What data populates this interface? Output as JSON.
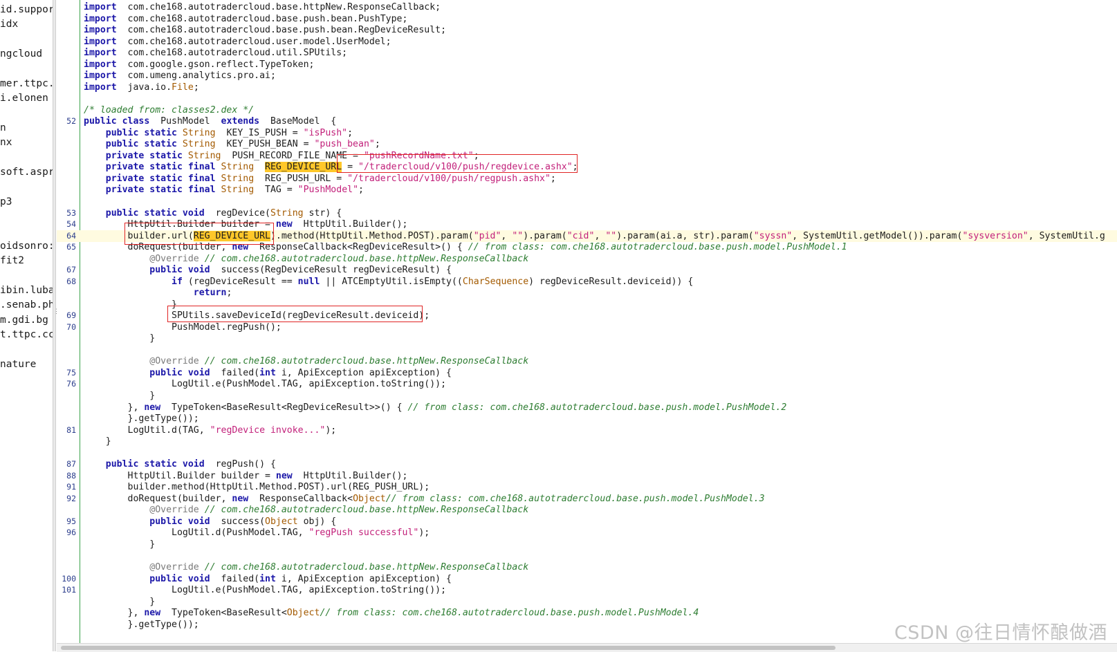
{
  "left_panel": {
    "items": [
      "id.suppor",
      "idx",
      "ngcloud",
      "mer.ttpc.",
      "i.elonen",
      "n",
      "nx",
      "soft.aspr",
      "p3",
      "oidsonro:",
      "fit2",
      "ibin.luba",
      ".senab.ph",
      "m.gdi.bg",
      "t.ttpc.cc",
      "nature"
    ]
  },
  "code_lines": [
    {
      "ln": "",
      "tokens": [
        [
          "kw",
          "import"
        ],
        [
          "",
          "  com.che168.autotradercloud.base.httpNew.ResponseCallback;"
        ]
      ]
    },
    {
      "ln": "",
      "tokens": [
        [
          "kw",
          "import"
        ],
        [
          "",
          "  com.che168.autotradercloud.base.push.bean.PushType;"
        ]
      ]
    },
    {
      "ln": "",
      "tokens": [
        [
          "kw",
          "import"
        ],
        [
          "",
          "  com.che168.autotradercloud.base.push.bean.RegDeviceResult;"
        ]
      ]
    },
    {
      "ln": "",
      "tokens": [
        [
          "kw",
          "import"
        ],
        [
          "",
          "  com.che168.autotradercloud.user.model.UserModel;"
        ]
      ]
    },
    {
      "ln": "",
      "tokens": [
        [
          "kw",
          "import"
        ],
        [
          "",
          "  com.che168.autotradercloud.util.SPUtils;"
        ]
      ]
    },
    {
      "ln": "",
      "tokens": [
        [
          "kw",
          "import"
        ],
        [
          "",
          "  com.google.gson.reflect.TypeToken;"
        ]
      ]
    },
    {
      "ln": "",
      "tokens": [
        [
          "kw",
          "import"
        ],
        [
          "",
          "  com.umeng.analytics.pro.ai;"
        ]
      ]
    },
    {
      "ln": "",
      "tokens": [
        [
          "kw",
          "import"
        ],
        [
          "",
          "  java.io."
        ],
        [
          "ty",
          "File"
        ],
        [
          "",
          ";"
        ]
      ]
    },
    {
      "ln": "",
      "tokens": []
    },
    {
      "ln": "",
      "tokens": [
        [
          "cm",
          "/* loaded from: classes2.dex */"
        ]
      ]
    },
    {
      "ln": "52",
      "tokens": [
        [
          "kw",
          "public class"
        ],
        [
          "",
          "  PushModel  "
        ],
        [
          "kw",
          "extends"
        ],
        [
          "",
          "  BaseModel  {"
        ]
      ]
    },
    {
      "ln": "",
      "tokens": [
        [
          "",
          "    "
        ],
        [
          "kw",
          "public static"
        ],
        [
          "",
          ""
        ],
        [
          "ty",
          " String"
        ],
        [
          "",
          "  KEY_IS_PUSH = "
        ],
        [
          "str",
          "\"isPush\""
        ],
        [
          "",
          ";"
        ]
      ]
    },
    {
      "ln": "",
      "tokens": [
        [
          "",
          "    "
        ],
        [
          "kw",
          "public static"
        ],
        [
          "ty",
          " String"
        ],
        [
          "",
          "  KEY_PUSH_BEAN = "
        ],
        [
          "str",
          "\"push_bean\""
        ],
        [
          "",
          ";"
        ]
      ]
    },
    {
      "ln": "",
      "tokens": [
        [
          "",
          "    "
        ],
        [
          "kw",
          "private static"
        ],
        [
          "ty",
          " String"
        ],
        [
          "",
          "  PUSH_RECORD_FILE_NAME = "
        ],
        [
          "str",
          "\"pushRecordName.txt\""
        ],
        [
          "",
          ";"
        ]
      ]
    },
    {
      "ln": "",
      "tokens": [
        [
          "",
          "    "
        ],
        [
          "kw",
          "private static final"
        ],
        [
          "ty",
          " String"
        ],
        [
          "",
          "  "
        ],
        [
          "sel",
          "REG_DEVICE_URL"
        ],
        [
          "",
          " = "
        ],
        [
          "str",
          "\"/tradercloud/v100/push/regdevice.ashx\""
        ],
        [
          "",
          ";"
        ]
      ]
    },
    {
      "ln": "",
      "tokens": [
        [
          "",
          "    "
        ],
        [
          "kw",
          "private static final"
        ],
        [
          "ty",
          " String"
        ],
        [
          "",
          "  REG_PUSH_URL = "
        ],
        [
          "str",
          "\"/tradercloud/v100/push/regpush.ashx\""
        ],
        [
          "",
          ";"
        ]
      ]
    },
    {
      "ln": "",
      "tokens": [
        [
          "",
          "    "
        ],
        [
          "kw",
          "private static final"
        ],
        [
          "ty",
          " String"
        ],
        [
          "",
          "  TAG = "
        ],
        [
          "str",
          "\"PushModel\""
        ],
        [
          "",
          ";"
        ]
      ]
    },
    {
      "ln": "",
      "tokens": []
    },
    {
      "ln": "53",
      "tokens": [
        [
          "",
          "    "
        ],
        [
          "kw",
          "public static void"
        ],
        [
          "",
          "  regDevice("
        ],
        [
          "ty",
          "String"
        ],
        [
          "",
          " str) {"
        ]
      ]
    },
    {
      "ln": "54",
      "tokens": [
        [
          "",
          "        HttpUtil.Builder builder = "
        ],
        [
          "kw",
          "new"
        ],
        [
          "",
          "  HttpUtil.Builder();"
        ]
      ]
    },
    {
      "ln": "64",
      "hl": true,
      "tokens": [
        [
          "",
          "        builder.url("
        ],
        [
          "sel",
          "REG_DEVICE_URL"
        ],
        [
          "",
          ").method(HttpUtil.Method.POST).param("
        ],
        [
          "str",
          "\"pid\""
        ],
        [
          "",
          ", "
        ],
        [
          "str",
          "\"\""
        ],
        [
          "",
          ").param("
        ],
        [
          "str",
          "\"cid\""
        ],
        [
          "",
          ", "
        ],
        [
          "str",
          "\"\""
        ],
        [
          "",
          ").param(ai.a, str).param("
        ],
        [
          "str",
          "\"syssn\""
        ],
        [
          "",
          ", SystemUtil.getModel()).param("
        ],
        [
          "str",
          "\"sysversion\""
        ],
        [
          "",
          ", SystemUtil.g"
        ]
      ]
    },
    {
      "ln": "65",
      "tokens": [
        [
          "",
          "        doRequest(builder, "
        ],
        [
          "kw",
          "new"
        ],
        [
          "",
          "  ResponseCallback<RegDeviceResult>() { "
        ],
        [
          "cm",
          "// from class: com.che168.autotradercloud.base.push.model.PushModel.1"
        ]
      ]
    },
    {
      "ln": "",
      "tokens": [
        [
          "",
          "            "
        ],
        [
          "an",
          "@Override"
        ],
        [
          "",
          " "
        ],
        [
          "cm",
          "// com.che168.autotradercloud.base.httpNew.ResponseCallback"
        ]
      ]
    },
    {
      "ln": "67",
      "tokens": [
        [
          "",
          "            "
        ],
        [
          "kw",
          "public void"
        ],
        [
          "",
          "  success(RegDeviceResult regDeviceResult) {"
        ]
      ]
    },
    {
      "ln": "68",
      "tokens": [
        [
          "",
          "                "
        ],
        [
          "kw",
          "if"
        ],
        [
          "",
          " (regDeviceResult == "
        ],
        [
          "kw",
          "null"
        ],
        [
          "",
          " || ATCEmptyUtil.isEmpty(("
        ],
        [
          "ty",
          "CharSequence"
        ],
        [
          "",
          ") regDeviceResult.deviceid)) {"
        ]
      ]
    },
    {
      "ln": "",
      "tokens": [
        [
          "",
          "                    "
        ],
        [
          "kw",
          "return"
        ],
        [
          "",
          ";"
        ]
      ]
    },
    {
      "ln": "",
      "tokens": [
        [
          "",
          "                }"
        ]
      ]
    },
    {
      "ln": "69",
      "tokens": [
        [
          "",
          "                SPUtils.saveDeviceId(regDeviceResult.deviceid);"
        ]
      ]
    },
    {
      "ln": "70",
      "tokens": [
        [
          "",
          "                PushModel.regPush();"
        ]
      ]
    },
    {
      "ln": "",
      "tokens": [
        [
          "",
          "            }"
        ]
      ]
    },
    {
      "ln": "",
      "tokens": []
    },
    {
      "ln": "",
      "tokens": [
        [
          "",
          "            "
        ],
        [
          "an",
          "@Override"
        ],
        [
          "",
          " "
        ],
        [
          "cm",
          "// com.che168.autotradercloud.base.httpNew.ResponseCallback"
        ]
      ]
    },
    {
      "ln": "75",
      "tokens": [
        [
          "",
          "            "
        ],
        [
          "kw",
          "public void"
        ],
        [
          "",
          "  failed("
        ],
        [
          "kw",
          "int"
        ],
        [
          "",
          " i, ApiException apiException) {"
        ]
      ]
    },
    {
      "ln": "76",
      "tokens": [
        [
          "",
          "                LogUtil.e(PushModel.TAG, apiException.toString());"
        ]
      ]
    },
    {
      "ln": "",
      "tokens": [
        [
          "",
          "            }"
        ]
      ]
    },
    {
      "ln": "",
      "tokens": [
        [
          "",
          "        }, "
        ],
        [
          "kw",
          "new"
        ],
        [
          "",
          "  TypeToken<BaseResult<RegDeviceResult>>() { "
        ],
        [
          "cm",
          "// from class: com.che168.autotradercloud.base.push.model.PushModel.2"
        ]
      ]
    },
    {
      "ln": "",
      "tokens": [
        [
          "",
          "        }.getType());"
        ]
      ]
    },
    {
      "ln": "81",
      "tokens": [
        [
          "",
          "        LogUtil.d(TAG, "
        ],
        [
          "str",
          "\"regDevice invoke...\""
        ],
        [
          "",
          ");"
        ]
      ]
    },
    {
      "ln": "",
      "tokens": [
        [
          "",
          "    }"
        ]
      ]
    },
    {
      "ln": "",
      "tokens": []
    },
    {
      "ln": "87",
      "tokens": [
        [
          "",
          "    "
        ],
        [
          "kw",
          "public static void"
        ],
        [
          "",
          "  regPush() {"
        ]
      ]
    },
    {
      "ln": "88",
      "tokens": [
        [
          "",
          "        HttpUtil.Builder builder = "
        ],
        [
          "kw",
          "new"
        ],
        [
          "",
          "  HttpUtil.Builder();"
        ]
      ]
    },
    {
      "ln": "91",
      "tokens": [
        [
          "",
          "        builder.method(HttpUtil.Method.POST).url(REG_PUSH_URL);"
        ]
      ]
    },
    {
      "ln": "92",
      "tokens": [
        [
          "",
          "        doRequest(builder, "
        ],
        [
          "kw",
          "new"
        ],
        [
          "",
          "  ResponseCallback<"
        ],
        [
          "ty",
          "Object"
        ],
        [
          ">() { "
        ],
        [
          "cm",
          "// from class: com.che168.autotradercloud.base.push.model.PushModel.3"
        ]
      ]
    },
    {
      "ln": "",
      "tokens": [
        [
          "",
          "            "
        ],
        [
          "an",
          "@Override"
        ],
        [
          "",
          " "
        ],
        [
          "cm",
          "// com.che168.autotradercloud.base.httpNew.ResponseCallback"
        ]
      ]
    },
    {
      "ln": "95",
      "tokens": [
        [
          "",
          "            "
        ],
        [
          "kw",
          "public void"
        ],
        [
          "",
          "  success("
        ],
        [
          "ty",
          "Object"
        ],
        [
          "",
          " obj) {"
        ]
      ]
    },
    {
      "ln": "96",
      "tokens": [
        [
          "",
          "                LogUtil.d(PushModel.TAG, "
        ],
        [
          "str",
          "\"regPush successful\""
        ],
        [
          "",
          ");"
        ]
      ]
    },
    {
      "ln": "",
      "tokens": [
        [
          "",
          "            }"
        ]
      ]
    },
    {
      "ln": "",
      "tokens": []
    },
    {
      "ln": "",
      "tokens": [
        [
          "",
          "            "
        ],
        [
          "an",
          "@Override"
        ],
        [
          "",
          " "
        ],
        [
          "cm",
          "// com.che168.autotradercloud.base.httpNew.ResponseCallback"
        ]
      ]
    },
    {
      "ln": "100",
      "tokens": [
        [
          "",
          "            "
        ],
        [
          "kw",
          "public void"
        ],
        [
          "",
          "  failed("
        ],
        [
          "kw",
          "int"
        ],
        [
          "",
          " i, ApiException apiException) {"
        ]
      ]
    },
    {
      "ln": "101",
      "tokens": [
        [
          "",
          "                LogUtil.e(PushModel.TAG, apiException.toString());"
        ]
      ]
    },
    {
      "ln": "",
      "tokens": [
        [
          "",
          "            }"
        ]
      ]
    },
    {
      "ln": "",
      "tokens": [
        [
          "",
          "        }, "
        ],
        [
          "kw",
          "new"
        ],
        [
          "",
          "  TypeToken<BaseResult<"
        ],
        [
          "ty",
          "Object"
        ],
        [
          ">>() { "
        ],
        [
          "cm",
          "// from class: com.che168.autotradercloud.base.push.model.PushModel.4"
        ]
      ]
    },
    {
      "ln": "",
      "tokens": [
        [
          "",
          "        }.getType());"
        ]
      ]
    }
  ],
  "watermark": "CSDN @往日情怀酿做酒"
}
